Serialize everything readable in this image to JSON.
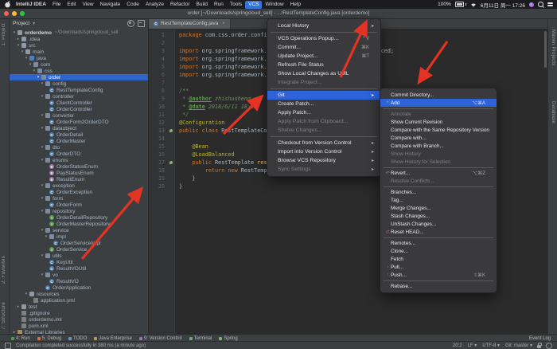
{
  "menubar": {
    "items": [
      {
        "label": "IntelliJ IDEA",
        "cls": "bold"
      },
      {
        "label": "File"
      },
      {
        "label": "Edit"
      },
      {
        "label": "View"
      },
      {
        "label": "Navigate"
      },
      {
        "label": "Code"
      },
      {
        "label": "Analyze"
      },
      {
        "label": "Refactor"
      },
      {
        "label": "Build"
      },
      {
        "label": "Run"
      },
      {
        "label": "Tools"
      },
      {
        "label": "VCS",
        "cls": "sel"
      },
      {
        "label": "Window"
      },
      {
        "label": "Help"
      }
    ],
    "status": {
      "battery": "100%",
      "clock": "6月11日 周一 17:26"
    }
  },
  "titlebar": {
    "title": "order [~/Downloads/springcloud_sell] - .../RestTemplateConfig.java [orderdemo]"
  },
  "left_strip": {
    "top_label": "1: Project",
    "bottom_labels": [
      "2: Favorites",
      "7: Structure"
    ]
  },
  "right_strip": {
    "labels": [
      "Maven Projects",
      "Database"
    ]
  },
  "project_panel": {
    "header": "Project",
    "tree": [
      {
        "label": "orderdemo",
        "indent": 0,
        "chev": "▾",
        "icon": "ic-folder",
        "cls": "bold",
        "note": "~/Downloads/springcloud_sell"
      },
      {
        "label": ".idea",
        "indent": 1,
        "chev": "▸",
        "icon": "ic-folder"
      },
      {
        "label": "src",
        "indent": 1,
        "chev": "▾",
        "icon": "ic-folder"
      },
      {
        "label": "main",
        "indent": 2,
        "chev": "▾",
        "icon": "ic-folder"
      },
      {
        "label": "java",
        "indent": 3,
        "chev": "▾",
        "icon": "ic-java"
      },
      {
        "label": "com",
        "indent": 4,
        "chev": "▾",
        "icon": "ic-pkg"
      },
      {
        "label": "css",
        "indent": 5,
        "chev": "▾",
        "icon": "ic-pkg"
      },
      {
        "label": "order",
        "indent": 6,
        "chev": "▾",
        "icon": "ic-pkg",
        "cls": "sel"
      },
      {
        "label": "config",
        "indent": 7,
        "chev": "▾",
        "icon": "ic-pkg"
      },
      {
        "label": "RestTemplateConfig",
        "indent": 8,
        "icon": "ic-class"
      },
      {
        "label": "controller",
        "indent": 7,
        "chev": "▾",
        "icon": "ic-pkg"
      },
      {
        "label": "ClientController",
        "indent": 8,
        "icon": "ic-class"
      },
      {
        "label": "OrderController",
        "indent": 8,
        "icon": "ic-class"
      },
      {
        "label": "converter",
        "indent": 7,
        "chev": "▾",
        "icon": "ic-pkg"
      },
      {
        "label": "OrderForm2OrderDTO",
        "indent": 8,
        "icon": "ic-class"
      },
      {
        "label": "dataobject",
        "indent": 7,
        "chev": "▾",
        "icon": "ic-pkg"
      },
      {
        "label": "OrderDetail",
        "indent": 8,
        "icon": "ic-class"
      },
      {
        "label": "OrderMaster",
        "indent": 8,
        "icon": "ic-class"
      },
      {
        "label": "dto",
        "indent": 7,
        "chev": "▾",
        "icon": "ic-pkg"
      },
      {
        "label": "OrderDTO",
        "indent": 8,
        "icon": "ic-class"
      },
      {
        "label": "enums",
        "indent": 7,
        "chev": "▾",
        "icon": "ic-pkg"
      },
      {
        "label": "OrderStatusEnum",
        "indent": 8,
        "icon": "ic-enum"
      },
      {
        "label": "PayStatusEnum",
        "indent": 8,
        "icon": "ic-enum"
      },
      {
        "label": "ResultEnum",
        "indent": 8,
        "icon": "ic-enum"
      },
      {
        "label": "exception",
        "indent": 7,
        "chev": "▾",
        "icon": "ic-pkg"
      },
      {
        "label": "OrderException",
        "indent": 8,
        "icon": "ic-class"
      },
      {
        "label": "form",
        "indent": 7,
        "chev": "▾",
        "icon": "ic-pkg"
      },
      {
        "label": "OrderForm",
        "indent": 8,
        "icon": "ic-class"
      },
      {
        "label": "repository",
        "indent": 7,
        "chev": "▾",
        "icon": "ic-pkg"
      },
      {
        "label": "OrderDetailRepository",
        "indent": 8,
        "icon": "ic-iface"
      },
      {
        "label": "OrderMasterRepository",
        "indent": 8,
        "icon": "ic-iface"
      },
      {
        "label": "service",
        "indent": 7,
        "chev": "▾",
        "icon": "ic-pkg"
      },
      {
        "label": "impl",
        "indent": 8,
        "chev": "▾",
        "icon": "ic-pkg"
      },
      {
        "label": "OrderServiceImpl",
        "indent": 9,
        "icon": "ic-class"
      },
      {
        "label": "OrderService",
        "indent": 8,
        "icon": "ic-iface"
      },
      {
        "label": "utils",
        "indent": 7,
        "chev": "▾",
        "icon": "ic-pkg"
      },
      {
        "label": "KeyUtil",
        "indent": 8,
        "icon": "ic-class"
      },
      {
        "label": "ResultVOUtil",
        "indent": 8,
        "icon": "ic-class"
      },
      {
        "label": "vo",
        "indent": 7,
        "chev": "▾",
        "icon": "ic-pkg"
      },
      {
        "label": "ResultVO",
        "indent": 8,
        "icon": "ic-class"
      },
      {
        "label": "OrderApplication",
        "indent": 7,
        "icon": "ic-class"
      },
      {
        "label": "resources",
        "indent": 3,
        "chev": "▾",
        "icon": "ic-folder"
      },
      {
        "label": "application.yml",
        "indent": 4,
        "icon": "ic-file"
      },
      {
        "label": "test",
        "indent": 1,
        "chev": "▸",
        "icon": "ic-folder"
      },
      {
        "label": ".gitignore",
        "indent": 1,
        "icon": "ic-file"
      },
      {
        "label": "orderdemo.iml",
        "indent": 1,
        "icon": "ic-file"
      },
      {
        "label": "pom.xml",
        "indent": 1,
        "icon": "ic-file"
      },
      {
        "label": "External Libraries",
        "indent": 0,
        "chev": "▸",
        "icon": "ic-lib"
      }
    ]
  },
  "editor": {
    "tab": {
      "label": "RestTemplateConfig.java",
      "close": "×"
    },
    "code": [
      {
        "n": "1",
        "t": [
          [
            "kw",
            "package "
          ],
          [
            "pl",
            "com.css.order.config;"
          ]
        ]
      },
      {
        "n": "2",
        "t": []
      },
      {
        "n": "3",
        "t": [
          [
            "kw",
            "import "
          ],
          [
            "pl",
            "org.springframework.cloud.client.loadbalancer.LoadBalanced;"
          ]
        ]
      },
      {
        "n": "4",
        "t": [
          [
            "kw",
            "import "
          ],
          [
            "pl",
            "org.springframework.context.annotation.Bean;"
          ]
        ]
      },
      {
        "n": "5",
        "t": [
          [
            "kw",
            "import "
          ],
          [
            "pl",
            "org.springframework.context.annotation.Configuration;"
          ]
        ]
      },
      {
        "n": "6",
        "t": [
          [
            "kw",
            "import "
          ],
          [
            "pl",
            "org.springframework.web.client.RestTemplate;"
          ]
        ]
      },
      {
        "n": "7",
        "t": []
      },
      {
        "n": "8",
        "t": [
          [
            "cm",
            "/**"
          ]
        ]
      },
      {
        "n": "9",
        "t": [
          [
            "cm",
            " * "
          ],
          [
            "doc",
            "@author"
          ],
          [
            "cm",
            " zhishusheng"
          ]
        ]
      },
      {
        "n": "10",
        "t": [
          [
            "cm",
            " * "
          ],
          [
            "doc",
            "@date"
          ],
          [
            "cm",
            " 2018/6/11 18:26"
          ]
        ]
      },
      {
        "n": "11",
        "t": [
          [
            "cm",
            " */"
          ]
        ]
      },
      {
        "n": "12",
        "t": [
          [
            "an",
            "@Configuration"
          ]
        ]
      },
      {
        "n": "13",
        "g": "leaf",
        "t": [
          [
            "kw",
            "public class "
          ],
          [
            "cn",
            "RestTemplateConfig"
          ],
          [
            "pl",
            " {"
          ]
        ]
      },
      {
        "n": "14",
        "t": []
      },
      {
        "n": "15",
        "t": [
          [
            "pl",
            "    "
          ],
          [
            "an",
            "@Bean"
          ]
        ]
      },
      {
        "n": "16",
        "t": [
          [
            "pl",
            "    "
          ],
          [
            "an",
            "@LoadBalanced"
          ]
        ]
      },
      {
        "n": "17",
        "g": "leaf",
        "t": [
          [
            "pl",
            "    "
          ],
          [
            "kw",
            "public "
          ],
          [
            "cn",
            "RestTemplate "
          ],
          [
            "mth",
            "restTemplate"
          ],
          [
            "pl",
            "() {"
          ]
        ]
      },
      {
        "n": "18",
        "t": [
          [
            "pl",
            "        "
          ],
          [
            "kw",
            "return new "
          ],
          [
            "cn",
            "RestTemplate"
          ],
          [
            "pl",
            "();"
          ]
        ]
      },
      {
        "n": "19",
        "t": [
          [
            "pl",
            "    }"
          ]
        ]
      },
      {
        "n": "20",
        "t": [
          [
            "pl",
            "}"
          ]
        ]
      }
    ]
  },
  "vcs_menu": {
    "items": [
      {
        "label": "Local History",
        "cls": "has-sub"
      },
      {
        "cls": "msep"
      },
      {
        "label": "VCS Operations Popup...",
        "shortcut": "⌃V"
      },
      {
        "label": "Commit...",
        "shortcut": "⌘K"
      },
      {
        "label": "Update Project...",
        "shortcut": "⌘T"
      },
      {
        "label": "Refresh File Status"
      },
      {
        "label": "Show Local Changes as UML"
      },
      {
        "label": "Integrate Project...",
        "cls": "dis"
      },
      {
        "cls": "msep"
      },
      {
        "label": "Git",
        "cls": "hl has-sub"
      },
      {
        "label": "Create Patch..."
      },
      {
        "label": "Apply Patch..."
      },
      {
        "label": "Apply Patch from Clipboard...",
        "cls": "dis"
      },
      {
        "label": "Shelve Changes...",
        "cls": "dis"
      },
      {
        "cls": "msep"
      },
      {
        "label": "Checkout from Version Control",
        "cls": "has-sub"
      },
      {
        "label": "Import into Version Control",
        "cls": "has-sub"
      },
      {
        "label": "Browse VCS Repository",
        "cls": "has-sub"
      },
      {
        "label": "Sync Settings",
        "cls": "dis has-sub"
      }
    ]
  },
  "git_menu": {
    "items": [
      {
        "label": "Commit Directory..."
      },
      {
        "label": "Add",
        "shortcut": "⌥⌘A",
        "cls": "hl",
        "icon": "ic-add",
        "glyph": "+"
      },
      {
        "cls": "msep"
      },
      {
        "label": "Annotate",
        "cls": "dis"
      },
      {
        "label": "Show Current Revision"
      },
      {
        "label": "Compare with the Same Repository Version"
      },
      {
        "label": "Compare with..."
      },
      {
        "label": "Compare with Branch..."
      },
      {
        "label": "Show History",
        "cls": "dis"
      },
      {
        "label": "Show History for Selection",
        "cls": "dis"
      },
      {
        "cls": "msep"
      },
      {
        "label": "Revert...",
        "shortcut": "⌥⌘Z",
        "icon": "ic-rev",
        "glyph": "↶"
      },
      {
        "label": "Resolve Conflicts...",
        "cls": "dis"
      },
      {
        "cls": "msep"
      },
      {
        "label": "Branches..."
      },
      {
        "label": "Tag..."
      },
      {
        "label": "Merge Changes..."
      },
      {
        "label": "Stash Changes..."
      },
      {
        "label": "UnStash Changes..."
      },
      {
        "label": "Reset HEAD...",
        "icon": "ic-reset",
        "glyph": "↺"
      },
      {
        "cls": "msep"
      },
      {
        "label": "Remotes..."
      },
      {
        "label": "Clone..."
      },
      {
        "label": "Fetch"
      },
      {
        "label": "Pull...",
        "icon": "ic-pull",
        "glyph": "↓"
      },
      {
        "label": "Push...",
        "shortcut": "⇧⌘K",
        "icon": "ic-push",
        "glyph": "↑"
      },
      {
        "cls": "msep"
      },
      {
        "label": "Rebase..."
      }
    ]
  },
  "bottom": {
    "tools": [
      {
        "label": "4: Run",
        "c": "#499c54"
      },
      {
        "label": "5: Debug",
        "c": "#d9714d"
      },
      {
        "label": "TODO",
        "c": "#6897bb"
      },
      {
        "label": "Java Enterprise",
        "c": "#b09a5e"
      },
      {
        "label": "9: Version Control",
        "c": "#9876aa"
      },
      {
        "label": "Terminal",
        "c": "#7aa37a"
      },
      {
        "label": "Spring",
        "c": "#77b767"
      }
    ],
    "event_log": "Event Log",
    "status_message": "Compilation completed successfully in 380 ms (a minute ago)",
    "status_right": [
      {
        "label": "20:2"
      },
      {
        "label": "LF ▾"
      },
      {
        "label": "UTF-8 ▾"
      },
      {
        "label": "Git: master ▾"
      }
    ]
  }
}
